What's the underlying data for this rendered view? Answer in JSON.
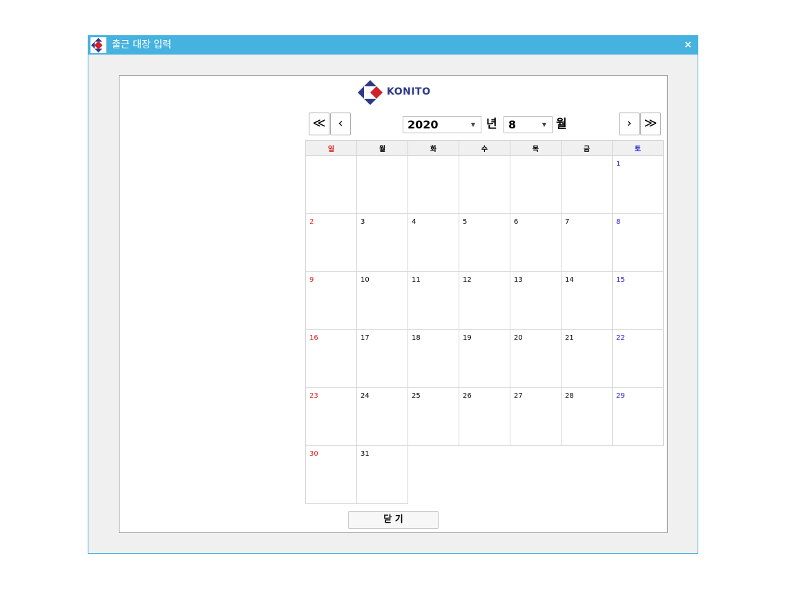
{
  "window": {
    "title": "출근 대장 입력",
    "close_glyph": "×"
  },
  "logo": {
    "text": "KONITO"
  },
  "nav": {
    "prev_year": "≪",
    "prev_month": "‹",
    "next_month": "›",
    "next_year": "≫"
  },
  "year_select": {
    "value": "2020",
    "unit": "년"
  },
  "month_select": {
    "value": "8",
    "unit": "월"
  },
  "weekdays": [
    "일",
    "월",
    "화",
    "수",
    "목",
    "금",
    "토"
  ],
  "weeks": [
    [
      "",
      "",
      "",
      "",
      "",
      "",
      "1"
    ],
    [
      "2",
      "3",
      "4",
      "5",
      "6",
      "7",
      "8"
    ],
    [
      "9",
      "10",
      "11",
      "12",
      "13",
      "14",
      "15"
    ],
    [
      "16",
      "17",
      "18",
      "19",
      "20",
      "21",
      "22"
    ],
    [
      "23",
      "24",
      "25",
      "26",
      "27",
      "28",
      "29"
    ],
    [
      "30",
      "31",
      null,
      null,
      null,
      null,
      null
    ]
  ],
  "footer": {
    "close_label": "닫 기"
  },
  "colors": {
    "titlebar": "#45b2e0",
    "sunday": "#e02020",
    "saturday": "#2020d0",
    "logo_blue": "#2e3a87",
    "logo_red": "#d0202a"
  },
  "icons": {
    "app": "konito-logo-icon",
    "close": "close-icon"
  }
}
